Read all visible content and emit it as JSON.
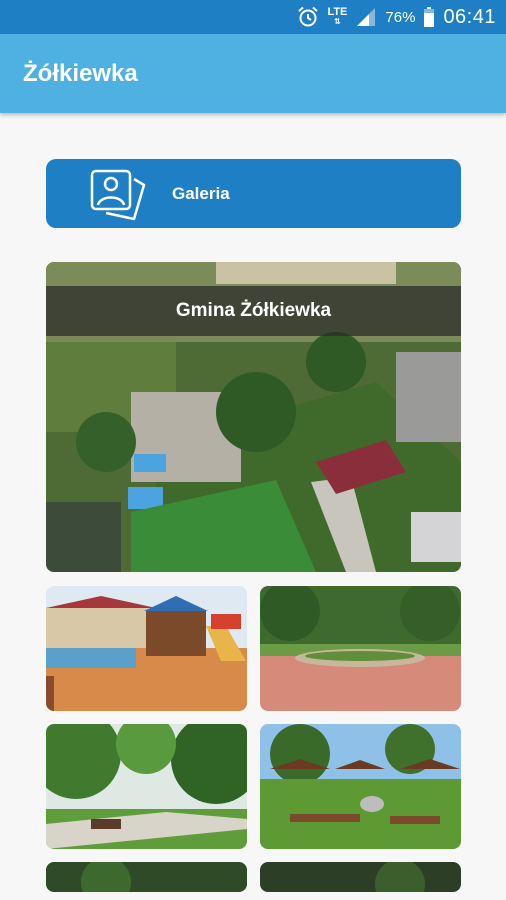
{
  "status_bar": {
    "network": "LTE",
    "battery": "76%",
    "time": "06:41"
  },
  "app_bar": {
    "title": "Żółkiewka"
  },
  "gallery_button": {
    "label": "Galeria",
    "icon": "photo-gallery-icon"
  },
  "hero_tile": {
    "caption": "Gmina Żółkiewka"
  },
  "colors": {
    "status_bar": "#1f7fc4",
    "app_bar": "#4fb0e2",
    "button": "#1f7fc4",
    "background": "#f7f7f7"
  }
}
